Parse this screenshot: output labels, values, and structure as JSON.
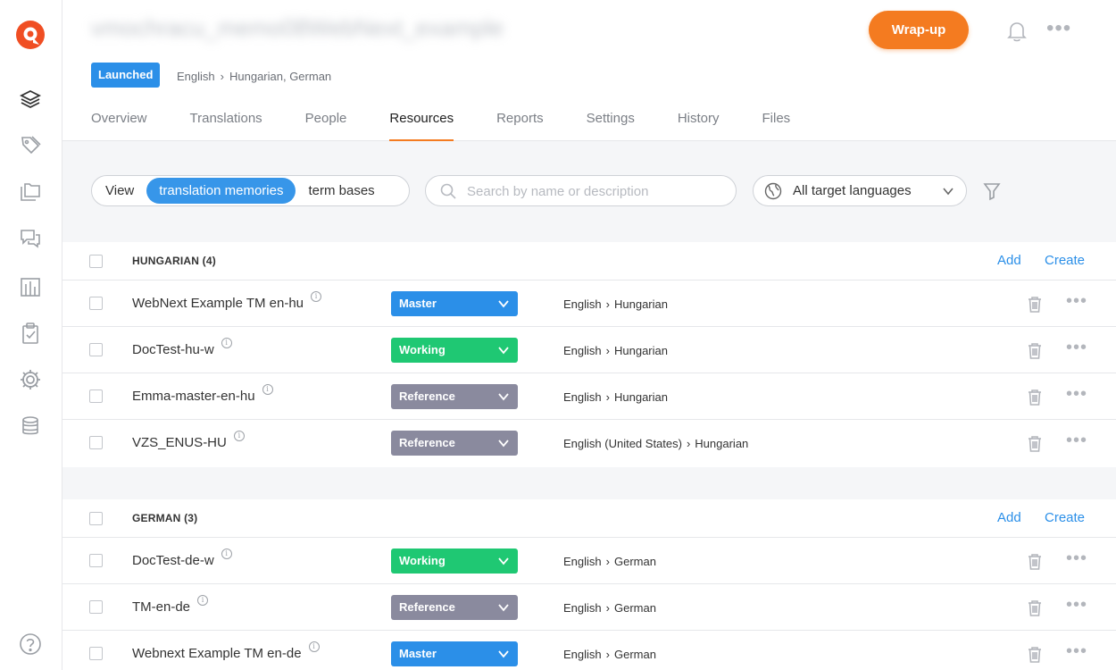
{
  "header": {
    "project_title": "vmochracu_memo08WebNext_example",
    "wrapup_label": "Wrap-up",
    "status": "Launched",
    "source_language": "English",
    "target_languages": "Hungarian, German"
  },
  "tabs": [
    {
      "label": "Overview"
    },
    {
      "label": "Translations"
    },
    {
      "label": "People"
    },
    {
      "label": "Resources"
    },
    {
      "label": "Reports"
    },
    {
      "label": "Settings"
    },
    {
      "label": "History"
    },
    {
      "label": "Files"
    }
  ],
  "toolbar": {
    "view_label": "View",
    "view_options": [
      "translation memories",
      "term bases"
    ],
    "search_placeholder": "Search by name or description",
    "lang_filter": "All target languages"
  },
  "sections": [
    {
      "title": "HUNGARIAN (4)",
      "add_label": "Add",
      "create_label": "Create",
      "rows": [
        {
          "name": "WebNext Example TM en-hu",
          "role": "Master",
          "source": "English",
          "target": "Hungarian"
        },
        {
          "name": "DocTest-hu-w",
          "role": "Working",
          "source": "English",
          "target": "Hungarian"
        },
        {
          "name": "Emma-master-en-hu",
          "role": "Reference",
          "source": "English",
          "target": "Hungarian"
        },
        {
          "name": "VZS_ENUS-HU",
          "role": "Reference",
          "source": "English (United States)",
          "target": "Hungarian"
        }
      ]
    },
    {
      "title": "GERMAN (3)",
      "add_label": "Add",
      "create_label": "Create",
      "rows": [
        {
          "name": "DocTest-de-w",
          "role": "Working",
          "source": "English",
          "target": "German"
        },
        {
          "name": "TM-en-de",
          "role": "Reference",
          "source": "English",
          "target": "German"
        },
        {
          "name": "Webnext Example TM en-de",
          "role": "Master",
          "source": "English",
          "target": "German"
        }
      ]
    }
  ],
  "colors": {
    "accent_orange": "#f47b20",
    "blue": "#2b8fe8",
    "master": "#2b8fe8",
    "working": "#1fc873",
    "reference": "#8a8a9e"
  }
}
